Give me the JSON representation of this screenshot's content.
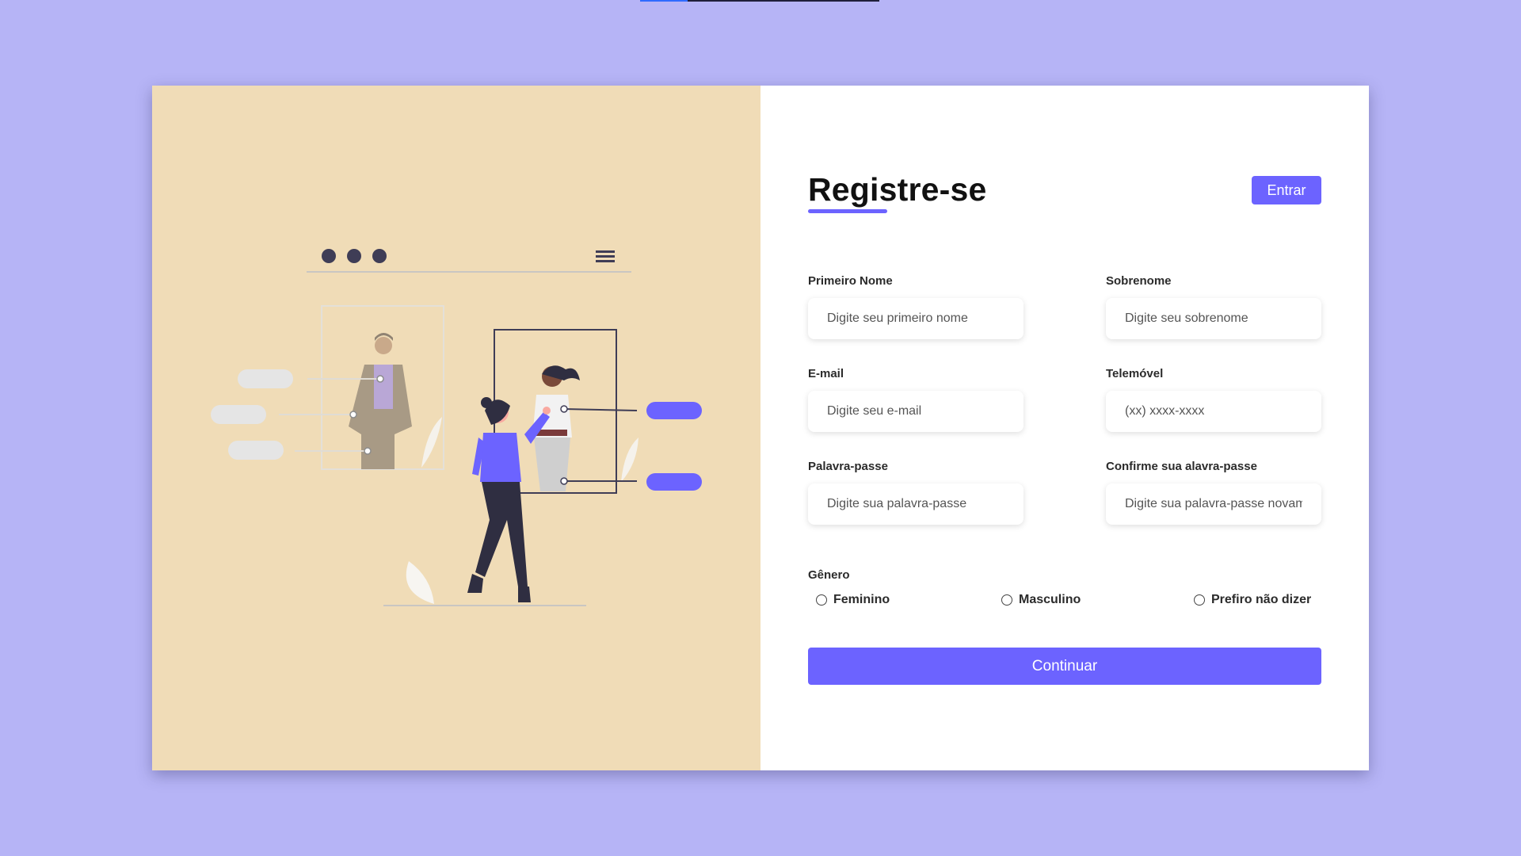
{
  "form": {
    "title": "Registre-se",
    "login_label": "Entrar",
    "fields": {
      "first_name": {
        "label": "Primeiro Nome",
        "placeholder": "Digite seu primeiro nome"
      },
      "last_name": {
        "label": "Sobrenome",
        "placeholder": "Digite seu sobrenome"
      },
      "email": {
        "label": "E-mail",
        "placeholder": "Digite seu e-mail"
      },
      "phone": {
        "label": "Telemóvel",
        "placeholder": "(xx) xxxx-xxxx"
      },
      "password": {
        "label": "Palavra-passe",
        "placeholder": "Digite sua palavra-passe"
      },
      "confirm_password": {
        "label": "Confirme sua alavra-passe",
        "placeholder": "Digite sua palavra-passe novamente"
      }
    },
    "gender": {
      "label": "Gênero",
      "options": [
        "Feminino",
        "Masculino",
        "Prefiro não dizer"
      ]
    },
    "continue_label": "Continuar"
  },
  "colors": {
    "page_background": "#b6b4f6",
    "illustration_background": "#f0dcb7",
    "accent": "#6c63ff"
  },
  "illustration": {
    "name": "online-profile-illustration"
  }
}
